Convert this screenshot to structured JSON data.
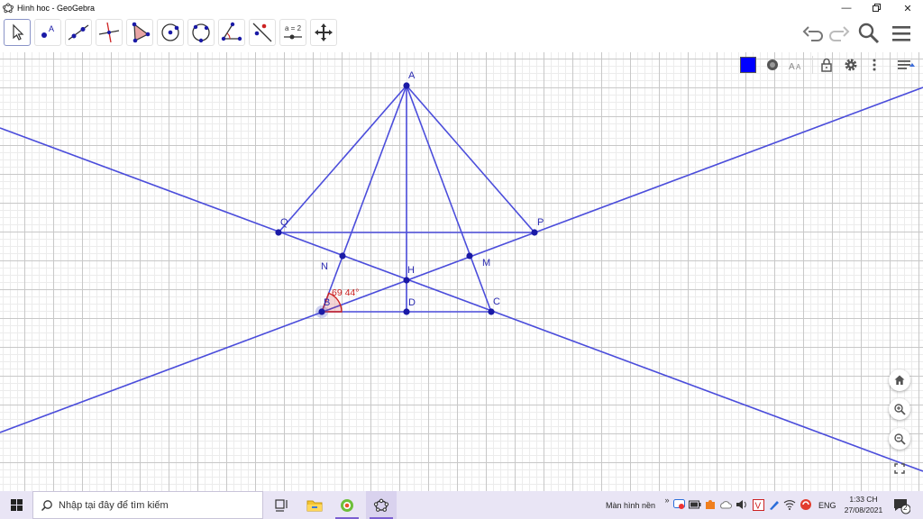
{
  "window": {
    "title": "Hình hoc - GeoGebra",
    "controls": [
      "minimize",
      "restore",
      "close"
    ]
  },
  "toolbar": {
    "tools": [
      {
        "name": "move-tool",
        "icon": "arrow-pointer-icon",
        "selected": true
      },
      {
        "name": "point-tool",
        "icon": "point-icon",
        "label": "A"
      },
      {
        "name": "line-tool",
        "icon": "line-icon"
      },
      {
        "name": "perpendicular-line-tool",
        "icon": "perpendicular-icon"
      },
      {
        "name": "polygon-tool",
        "icon": "polygon-icon"
      },
      {
        "name": "circle-tool",
        "icon": "circle-center-point-icon"
      },
      {
        "name": "circle-three-points-tool",
        "icon": "circle-three-points-icon"
      },
      {
        "name": "angle-tool",
        "icon": "angle-icon"
      },
      {
        "name": "reflect-tool",
        "icon": "reflect-line-icon"
      },
      {
        "name": "slider-tool",
        "icon": "slider-icon",
        "label": "a = 2"
      },
      {
        "name": "move-graphics-tool",
        "icon": "move-cross-icon"
      }
    ],
    "right": [
      "undo-icon",
      "redo-icon",
      "search-icon",
      "menu-icon"
    ]
  },
  "stylebar": {
    "color": "#0000ff",
    "items": [
      "color-swatch",
      "point-style-icon",
      "text-size-icon",
      "lock-icon",
      "gear-icon",
      "more-icon",
      "toggle-stylebar-icon"
    ]
  },
  "figure": {
    "line_color": "#4b4ddb",
    "point_color": "#1a1aa6",
    "angle_color": "#cc2222",
    "points": {
      "A": {
        "label": "A"
      },
      "B": {
        "label": "B"
      },
      "C": {
        "label": "C"
      },
      "D": {
        "label": "D"
      },
      "H": {
        "label": "H"
      },
      "M": {
        "label": "M"
      },
      "N": {
        "label": "N"
      },
      "P": {
        "label": "P"
      },
      "Q": {
        "label": "Q"
      }
    },
    "angle_label": "69 44°"
  },
  "zoom": [
    "home-icon",
    "zoom-in-icon",
    "zoom-out-icon",
    "fullscreen-icon"
  ],
  "taskbar": {
    "search_placeholder": "Nhập tại đây để tìm kiếm",
    "desktop_label": "Màn hình nền",
    "language": "ENG",
    "time": "1:33 CH",
    "date": "27/08/2021",
    "notification_count": "2"
  }
}
